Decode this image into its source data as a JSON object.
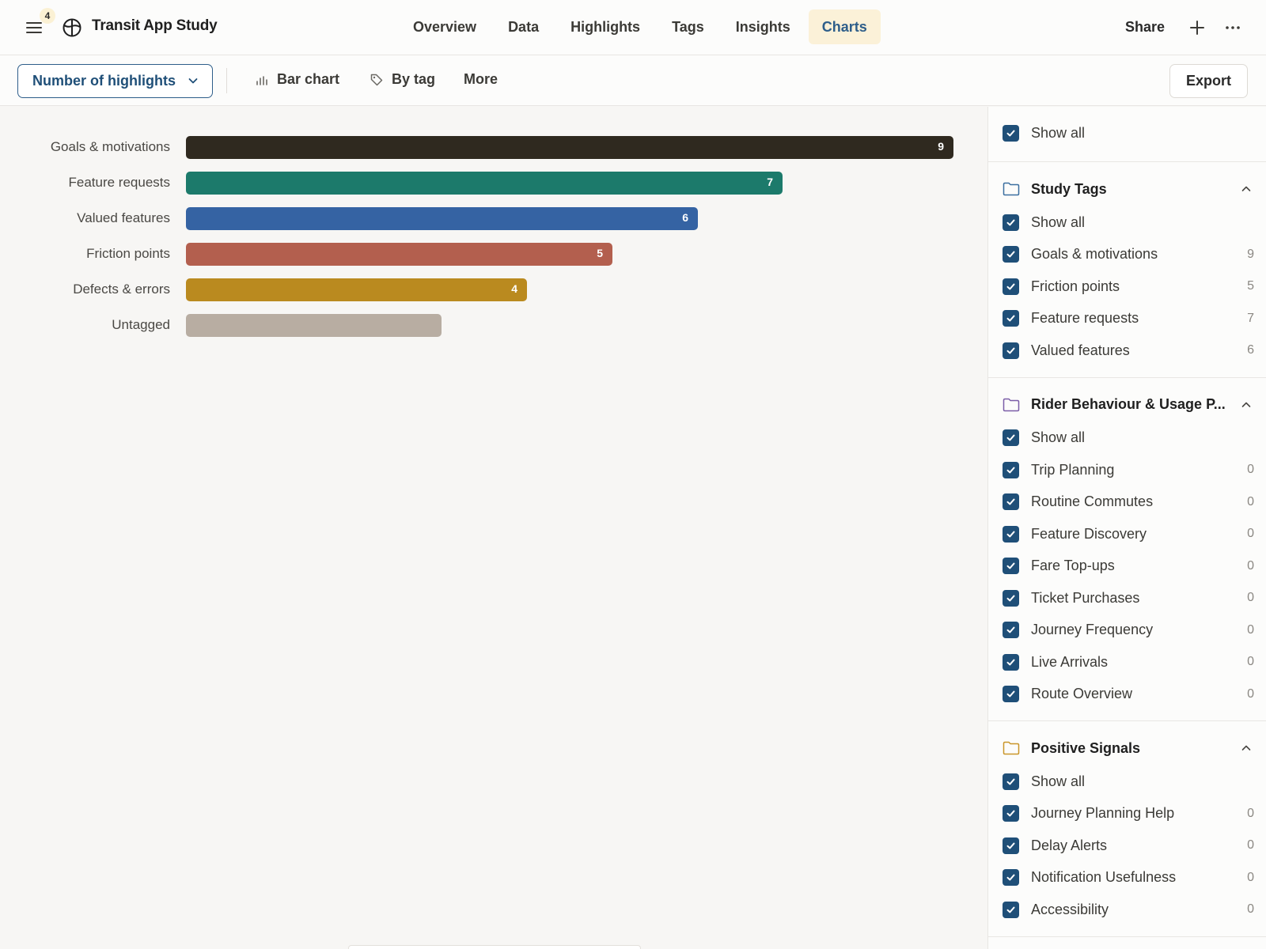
{
  "app": {
    "badge_count": "4",
    "title": "Transit App Study"
  },
  "tabs": [
    {
      "label": "Overview"
    },
    {
      "label": "Data"
    },
    {
      "label": "Highlights"
    },
    {
      "label": "Tags"
    },
    {
      "label": "Insights"
    },
    {
      "label": "Charts",
      "active": true
    }
  ],
  "header_actions": {
    "share_label": "Share"
  },
  "toolbar": {
    "metric_label": "Number of highlights",
    "chart_type_label": "Bar chart",
    "group_by_label": "By tag",
    "more_label": "More",
    "export_label": "Export"
  },
  "chart_data": {
    "type": "bar",
    "orientation": "horizontal",
    "categories": [
      "Goals & motivations",
      "Feature requests",
      "Valued features",
      "Friction points",
      "Defects & errors",
      "Untagged"
    ],
    "values": [
      9,
      7,
      6,
      5,
      4,
      3
    ],
    "value_labels": [
      "9",
      "7",
      "6",
      "5",
      "4",
      ""
    ],
    "colors": [
      "#2f291f",
      "#1c7a6b",
      "#3563a3",
      "#b35f4e",
      "#ba8a1f",
      "#b8ada2"
    ],
    "xlim": [
      0,
      9
    ]
  },
  "panel": {
    "show_all_label": "Show all",
    "groups": [
      {
        "title": "Study Tags",
        "folder_color": "#3b6fa0",
        "show_all_label": "Show all",
        "items": [
          {
            "label": "Goals & motivations",
            "count": "9"
          },
          {
            "label": "Friction points",
            "count": "5"
          },
          {
            "label": "Feature requests",
            "count": "7"
          },
          {
            "label": "Valued features",
            "count": "6"
          }
        ]
      },
      {
        "title": "Rider Behaviour & Usage P...",
        "folder_color": "#7b5ea8",
        "show_all_label": "Show all",
        "items": [
          {
            "label": "Trip Planning",
            "count": "0"
          },
          {
            "label": "Routine Commutes",
            "count": "0"
          },
          {
            "label": "Feature Discovery",
            "count": "0"
          },
          {
            "label": "Fare Top-ups",
            "count": "0"
          },
          {
            "label": "Ticket Purchases",
            "count": "0"
          },
          {
            "label": "Journey Frequency",
            "count": "0"
          },
          {
            "label": "Live Arrivals",
            "count": "0"
          },
          {
            "label": "Route Overview",
            "count": "0"
          }
        ]
      },
      {
        "title": "Positive Signals",
        "folder_color": "#c9962a",
        "show_all_label": "Show all",
        "items": [
          {
            "label": "Journey Planning Help",
            "count": "0"
          },
          {
            "label": "Delay Alerts",
            "count": "0"
          },
          {
            "label": "Notification Usefulness",
            "count": "0"
          },
          {
            "label": "Accessibility",
            "count": "0"
          }
        ]
      }
    ]
  }
}
